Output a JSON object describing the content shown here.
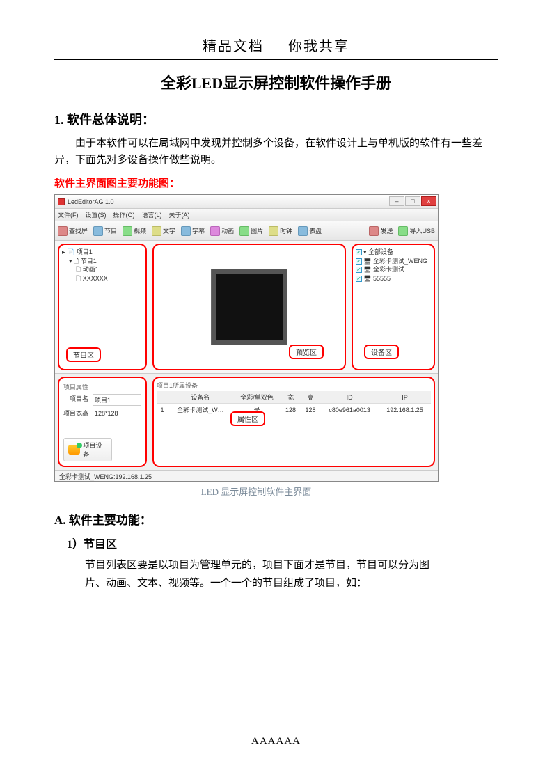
{
  "header": {
    "left": "精品文档",
    "right": "你我共享"
  },
  "title": "全彩LED显示屏控制软件操作手册",
  "section1": {
    "heading": "1. 软件总体说明：",
    "para": "由于本软件可以在局域网中发现并控制多个设备，在软件设计上与单机版的软件有一些差异，下面先对多设备操作做些说明。"
  },
  "red_label": "软件主界面图主要功能图：",
  "screenshot": {
    "window_title": "LedEditorAG 1.0",
    "menus": [
      "文件(F)",
      "设置(S)",
      "操作(O)",
      "语言(L)",
      "关于(A)"
    ],
    "toolbar": [
      "查找屏",
      "节目",
      "视频",
      "文字",
      "字幕",
      "动画",
      "图片",
      "时钟",
      "表盘",
      "发送",
      "导入USB"
    ],
    "program_tree": {
      "root": "项目1",
      "child": "节目1",
      "leaves": [
        "动画1",
        "XXXXXX"
      ]
    },
    "labels": {
      "program": "节目区",
      "preview": "预览区",
      "device": "设备区",
      "props": "属性区"
    },
    "device_tree": {
      "root": "全部设备",
      "items": [
        "全彩卡测试_WENG",
        "全彩卡测试",
        "55555"
      ]
    },
    "props_left": {
      "name_label": "项目名",
      "name_value": "项目1",
      "size_label": "项目宽高",
      "size_value": "128*128",
      "button": "项目设备"
    },
    "table": {
      "headers": [
        "",
        "设备名",
        "全彩/单双色",
        "宽",
        "高",
        "ID",
        "IP"
      ],
      "row": [
        "1",
        "全彩卡测试_W…",
        "是",
        "128",
        "128",
        "c80e961a0013",
        "192.168.1.25"
      ]
    },
    "statusbar": "全彩卡测试_WENG:192.168.1.25"
  },
  "caption": "LED 显示屏控制软件主界面",
  "sectionA": {
    "heading": "A. 软件主要功能：",
    "item1_heading": "1）节目区",
    "item1_body": "节目列表区要是以项目为管理单元的，项目下面才是节目，节目可以分为图片、动画、文本、视频等。一个一个的节目组成了项目，如："
  },
  "footer": "AAAAAA"
}
